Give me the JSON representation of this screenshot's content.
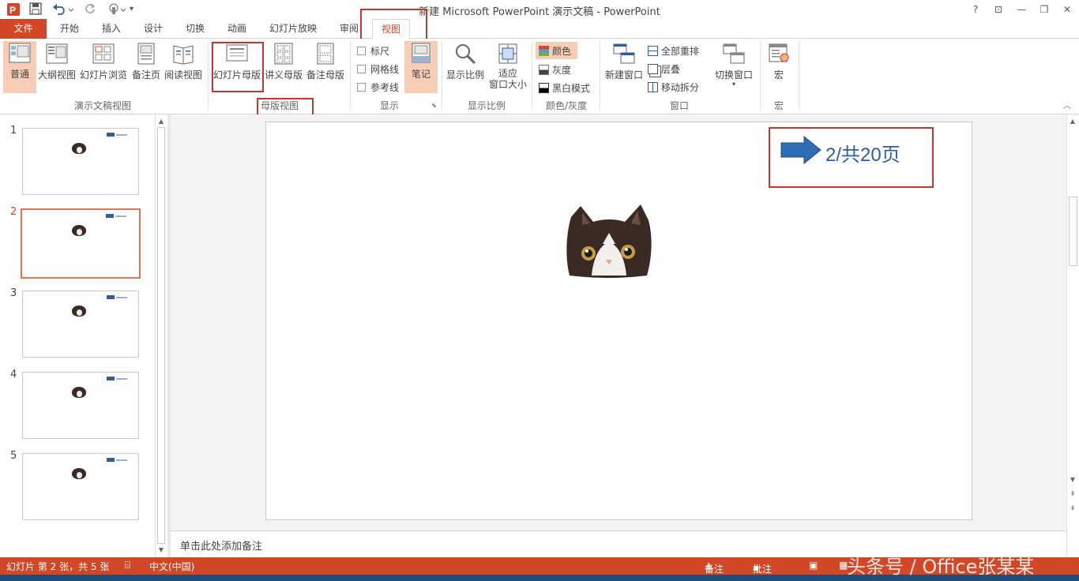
{
  "window": {
    "title": "新建 Microsoft PowerPoint 演示文稿 - PowerPoint",
    "help": "?",
    "controls": [
      "⊡",
      "—",
      "❐",
      "✕"
    ]
  },
  "qat": {
    "app_icon": "powerpoint-icon",
    "save_icon": "save-icon",
    "undo_icon": "undo-icon",
    "redo_icon": "redo-icon",
    "touch_icon": "touch-mode-icon"
  },
  "tabs": [
    {
      "label": "文件"
    },
    {
      "label": "开始"
    },
    {
      "label": "插入"
    },
    {
      "label": "设计"
    },
    {
      "label": "切换"
    },
    {
      "label": "动画"
    },
    {
      "label": "幻灯片放映"
    },
    {
      "label": "审阅"
    },
    {
      "label": "视图"
    }
  ],
  "ribbon": {
    "presentation_views": {
      "label": "演示文稿视图",
      "buttons": [
        {
          "label": "普通"
        },
        {
          "label": "大纲视图"
        },
        {
          "label": "幻灯片浏览"
        },
        {
          "label": "备注页"
        },
        {
          "label": "阅读视图"
        }
      ]
    },
    "master_views": {
      "label": "母版视图",
      "buttons": [
        {
          "label": "幻灯片母版"
        },
        {
          "label": "讲义母版"
        },
        {
          "label": "备注母版"
        }
      ]
    },
    "show": {
      "label": "显示",
      "checks": [
        {
          "label": "标尺"
        },
        {
          "label": "网格线"
        },
        {
          "label": "参考线"
        }
      ],
      "notes_button": "笔记"
    },
    "zoom": {
      "label": "显示比例",
      "zoom_button": "显示比例",
      "fit_button_line1": "适应",
      "fit_button_line2": "窗口大小"
    },
    "color": {
      "label": "颜色/灰度",
      "items": [
        {
          "label": "颜色"
        },
        {
          "label": "灰度"
        },
        {
          "label": "黑白模式"
        }
      ]
    },
    "window": {
      "label": "窗口",
      "new_window": "新建窗口",
      "arrange_all": "全部重排",
      "cascade": "层叠",
      "move_split": "移动拆分",
      "switch_windows": "切换窗口"
    },
    "macros": {
      "label": "宏",
      "button": "宏"
    }
  },
  "slides": [
    {
      "number": "1"
    },
    {
      "number": "2"
    },
    {
      "number": "3"
    },
    {
      "number": "4"
    },
    {
      "number": "5"
    }
  ],
  "current_slide": {
    "text": "2/共20页"
  },
  "notes_placeholder": "单击此处添加备注",
  "status": {
    "slide_info": "幻灯片 第 2 张，共 5 张",
    "language": "中文(中国)",
    "notes": "备注",
    "comments": "批注"
  },
  "watermark": "头条号 / Office张某某",
  "colors": {
    "accent": "#d24726",
    "arrow_blue": "#2e6db4",
    "text_blue": "#2e5f9c",
    "highlight_red": "#c0392b"
  }
}
